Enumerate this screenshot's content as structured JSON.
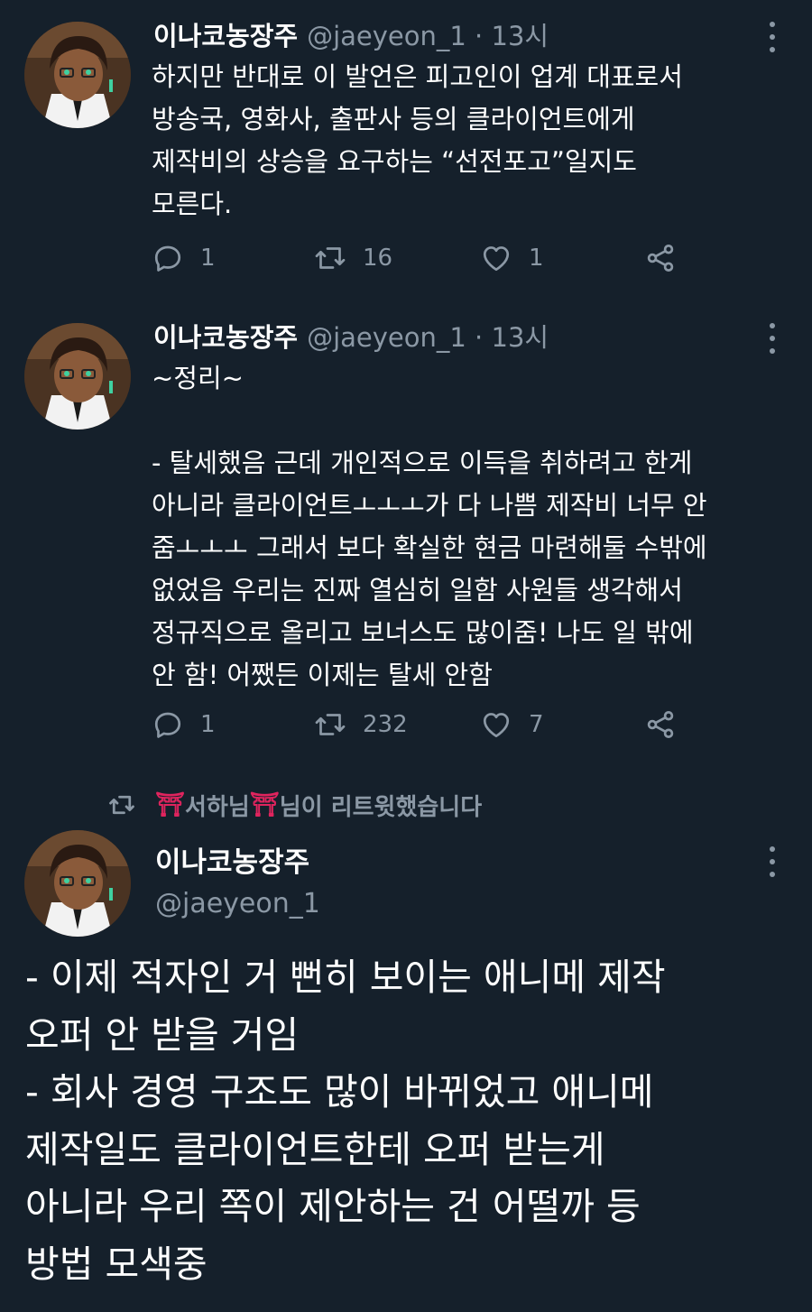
{
  "tweets": [
    {
      "name": "이나코농장주",
      "handle_time": "@jaeyeon_1 · 13시",
      "text": "하지만 반대로 이 발언은 피고인이 업계 대표로서\n방송국, 영화사, 출판사 등의 클라이언트에게\n제작비의 상승을 요구하는 “선전포고”일지도\n모른다.",
      "reply_count": "1",
      "retweet_count": "16",
      "like_count": "1"
    },
    {
      "name": "이나코농장주",
      "handle_time": "@jaeyeon_1 · 13시",
      "text": "~정리~\n\n- 탈세했음 근데 개인적으로 이득을 취하려고 한게\n아니라 클라이언트ㅗㅗㅗ가 다 나쁨 제작비 너무 안\n줌ㅗㅗㅗ 그래서 보다 확실한 현금 마련해둘 수밖에\n없었음 우리는 진짜 열심히 일함 사원들 생각해서\n정규직으로 올리고 보너스도 많이줌! 나도 일 밖에\n안 함! 어쨌든 이제는 탈세 안함",
      "reply_count": "1",
      "retweet_count": "232",
      "like_count": "7"
    }
  ],
  "retweet_banner": {
    "torii_left": "⛩",
    "user": "서하님",
    "torii_right": "⛩",
    "suffix": " 님이 리트윗했습니다"
  },
  "main_tweet": {
    "name": "이나코농장주",
    "handle": "@jaeyeon_1",
    "text": "- 이제 적자인 거 뻔히 보이는 애니메 제작\n오퍼 안 받을 거임\n- 회사 경영 구조도 많이 바뀌었고 애니메\n제작일도 클라이언트한테 오퍼 받는게\n아니라 우리 쪽이 제안하는 건 어떨까 등\n방법 모색중"
  },
  "icons": {
    "reply": "reply-icon",
    "retweet": "retweet-icon",
    "like": "heart-icon",
    "share": "share-icon",
    "more": "more-icon"
  },
  "colors": {
    "background": "#15202b",
    "text": "#ffffff",
    "secondary": "#8b98a5",
    "torii": "#e0245e"
  }
}
